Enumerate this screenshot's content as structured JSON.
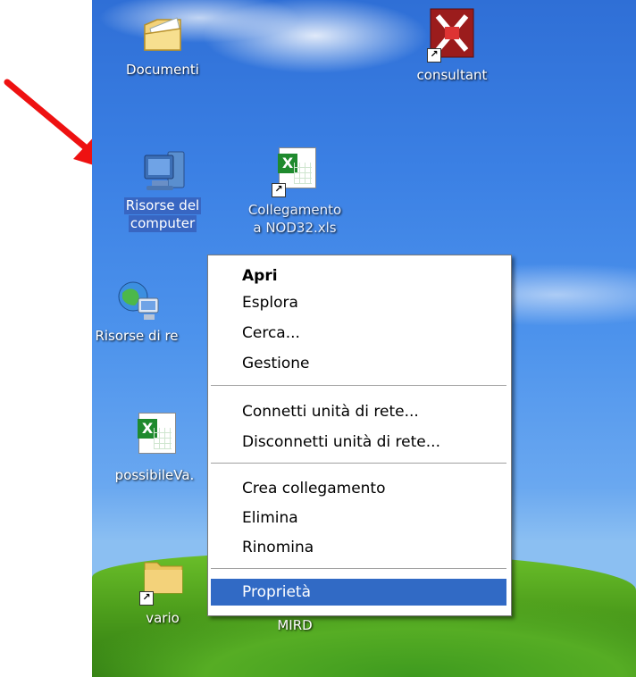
{
  "desktop": {
    "icons": [
      {
        "id": "documenti",
        "label": "Documenti",
        "selected": false,
        "icon": "my-documents-icon"
      },
      {
        "id": "consultant",
        "label": "consultant",
        "selected": false,
        "icon": "app-shortcut-icon"
      },
      {
        "id": "risorse-computer",
        "label": "Risorse del computer",
        "label_line1": "Risorse del",
        "label_line2": "computer",
        "selected": true,
        "icon": "my-computer-icon"
      },
      {
        "id": "nod32",
        "label_line1": "Collegamento",
        "label_line2": "a NOD32.xls",
        "selected": false,
        "icon": "excel-shortcut-icon"
      },
      {
        "id": "risorse-rete",
        "label": "Risorse di re",
        "selected": false,
        "icon": "network-places-icon"
      },
      {
        "id": "possibile",
        "label": "possibileVa.",
        "selected": false,
        "icon": "excel-file-icon"
      },
      {
        "id": "vario",
        "label": "vario",
        "selected": false,
        "icon": "folder-shortcut-icon"
      },
      {
        "id": "mird",
        "label": "MIRD",
        "selected": false,
        "icon": "unknown"
      }
    ],
    "shortcut_glyph": "↗"
  },
  "context_menu": {
    "items": [
      {
        "label": "Apri",
        "bold": true
      },
      {
        "label": "Esplora"
      },
      {
        "label": "Cerca..."
      },
      {
        "label": "Gestione"
      },
      {
        "label": "Connetti unità di rete..."
      },
      {
        "label": "Disconnetti unità di rete..."
      },
      {
        "label": "Crea collegamento"
      },
      {
        "label": "Elimina"
      },
      {
        "label": "Rinomina"
      },
      {
        "label": "Proprietà",
        "highlighted": true
      }
    ]
  },
  "colors": {
    "menu_highlight": "#316ac5",
    "selection": "#3866c2",
    "arrow": "#ee1111"
  }
}
